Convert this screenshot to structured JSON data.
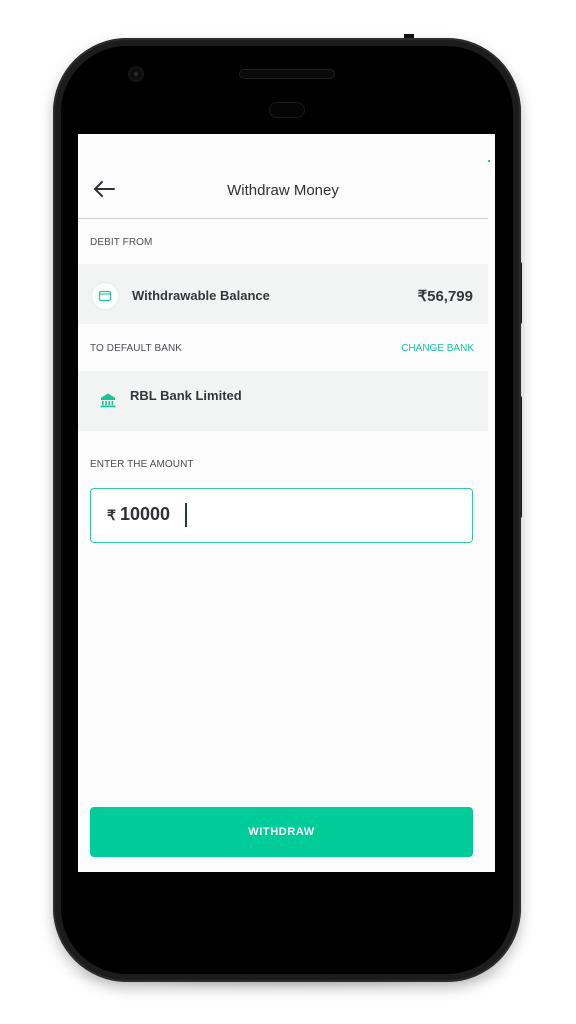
{
  "header": {
    "title": "Withdraw Money",
    "back_icon": "back-arrow-icon"
  },
  "debit": {
    "label": "DEBIT FROM",
    "source_label": "Withdrawable Balance",
    "amount": "₹56,799",
    "icon": "wallet-icon"
  },
  "bank": {
    "label": "TO DEFAULT BANK",
    "change_label": "CHANGE BANK",
    "name": "RBL Bank Limited",
    "icon": "bank-icon"
  },
  "amount_input": {
    "label": "ENTER THE AMOUNT",
    "currency": "₹",
    "value": "10000"
  },
  "action": {
    "withdraw_label": "WITHDRAW"
  },
  "colors": {
    "accent": "#00cc9a",
    "card_bg": "#f2f4f3",
    "text": "#34363c"
  }
}
